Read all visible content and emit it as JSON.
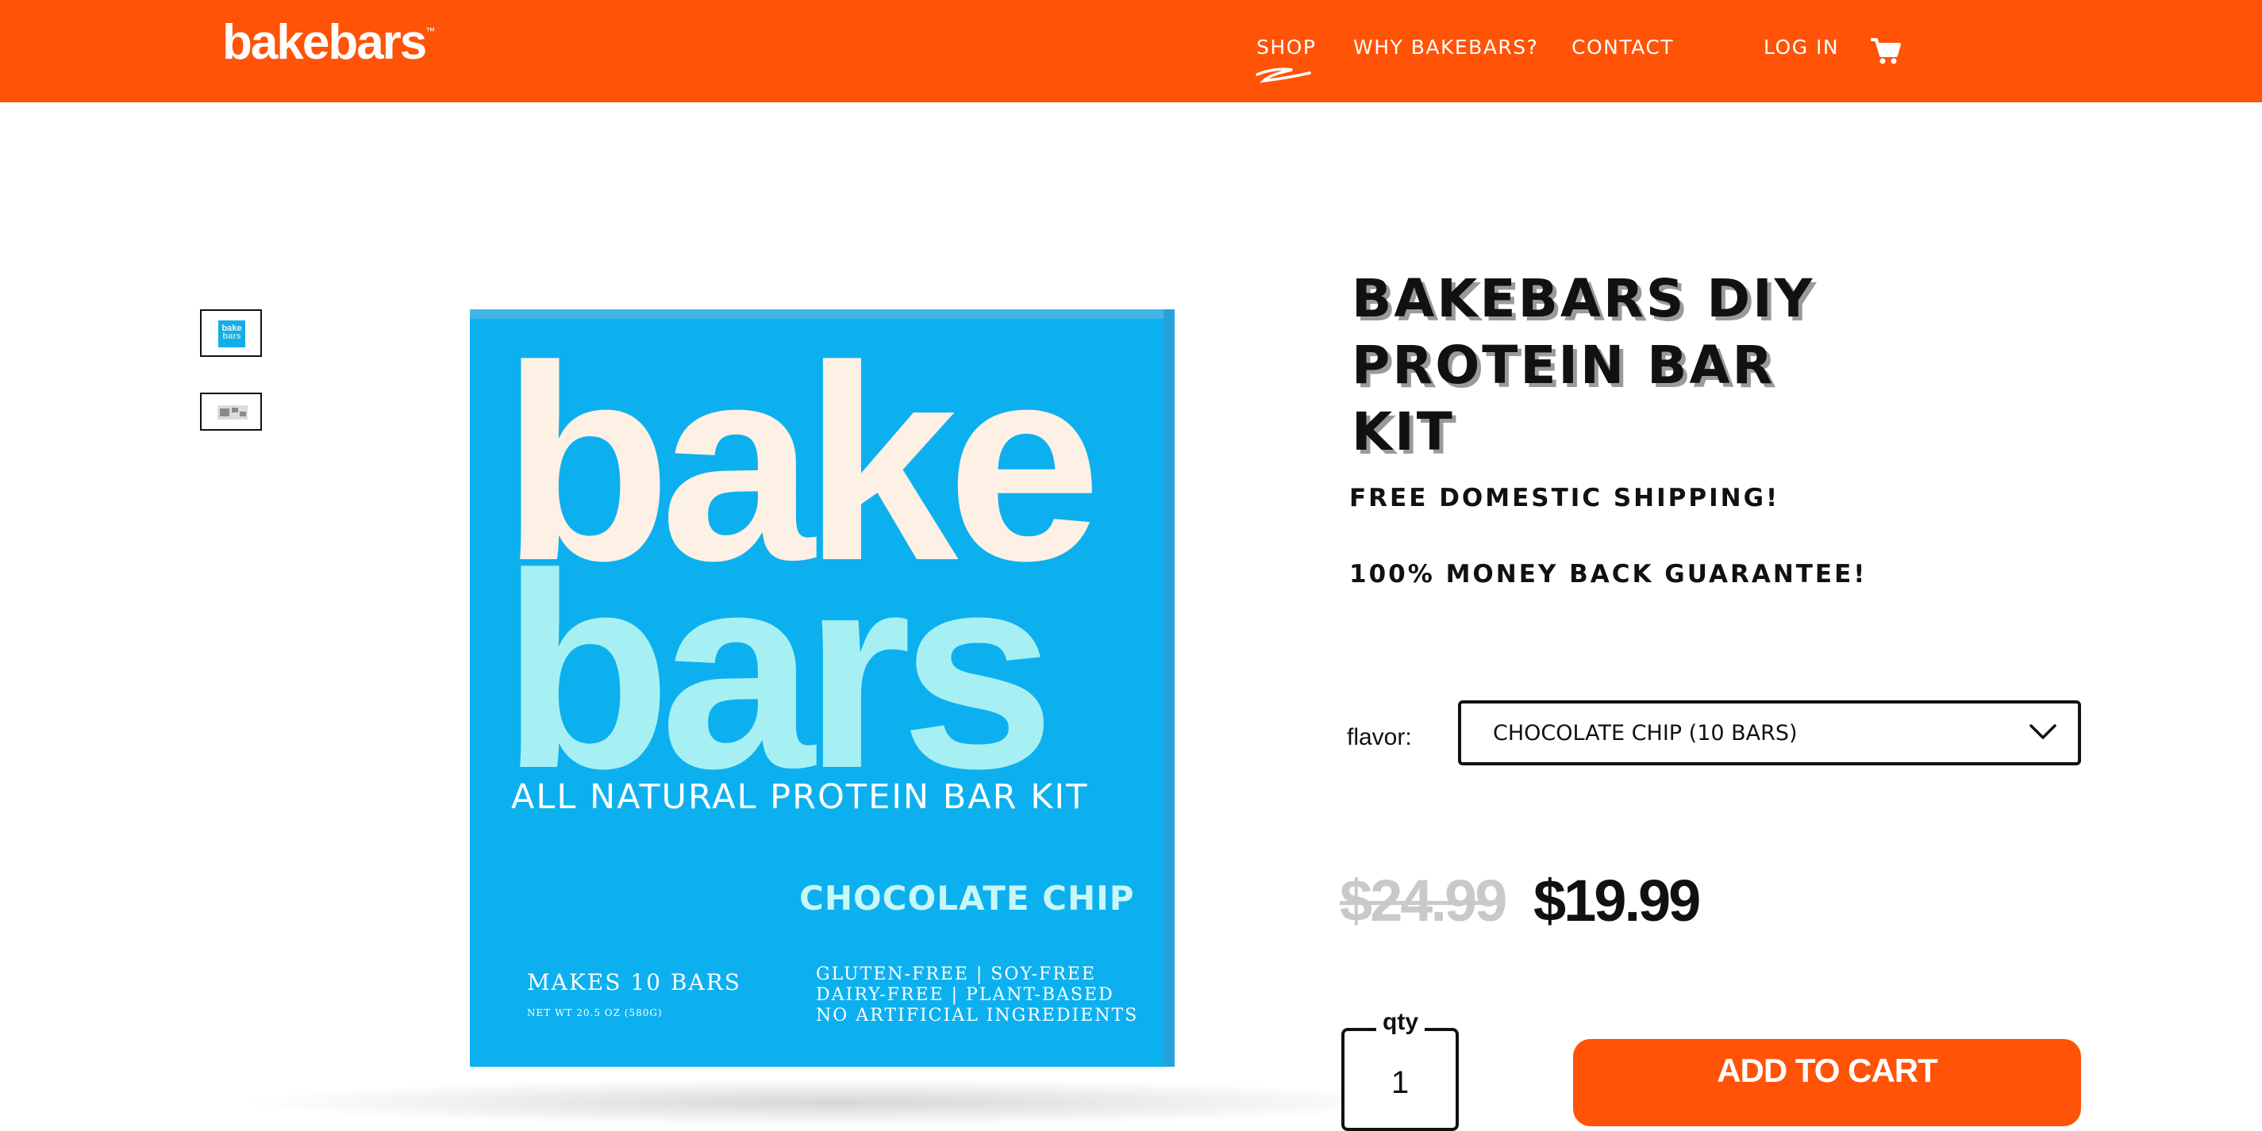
{
  "colors": {
    "brand_orange": "#ff5308",
    "box_blue": "#0db0ef",
    "text_dark": "#111111",
    "strike_gray": "#c9c9c9"
  },
  "header": {
    "logo": "bakebars",
    "logo_tm": "™",
    "nav": [
      {
        "label": "SHOP",
        "active": true
      },
      {
        "label": "WHY BAKEBARS?"
      },
      {
        "label": "CONTACT"
      },
      {
        "label": "LOG IN"
      }
    ],
    "cart_icon": "shopping-cart-icon"
  },
  "gallery": {
    "thumbnails": [
      {
        "mini_line1": "bake",
        "mini_line2": "bars"
      },
      {}
    ],
    "box": {
      "word1": "bake",
      "word2": "bars",
      "tagline": "ALL NATURAL PROTEIN BAR KIT",
      "flavor": "CHOCOLATE CHIP",
      "makes": "MAKES 10 BARS",
      "net_wt": "NET WT 20.5 OZ (580G)",
      "claims": [
        "GLUTEN-FREE | SOY-FREE",
        "DAIRY-FREE | PLANT-BASED",
        "NO ARTIFICIAL INGREDIENTS"
      ]
    }
  },
  "product": {
    "title_lines": [
      "BAKEBARS DIY",
      "PROTEIN BAR",
      "KIT"
    ],
    "promo1": "FREE DOMESTIC SHIPPING!",
    "promo2": "100% MONEY BACK GUARANTEE!",
    "flavor_label": "flavor:",
    "flavor_selected": "CHOCOLATE CHIP (10 BARS)",
    "old_price": "$24.99",
    "price": "$19.99",
    "qty_label": "qty",
    "qty_value": "1",
    "add_to_cart": "ADD TO CART"
  }
}
